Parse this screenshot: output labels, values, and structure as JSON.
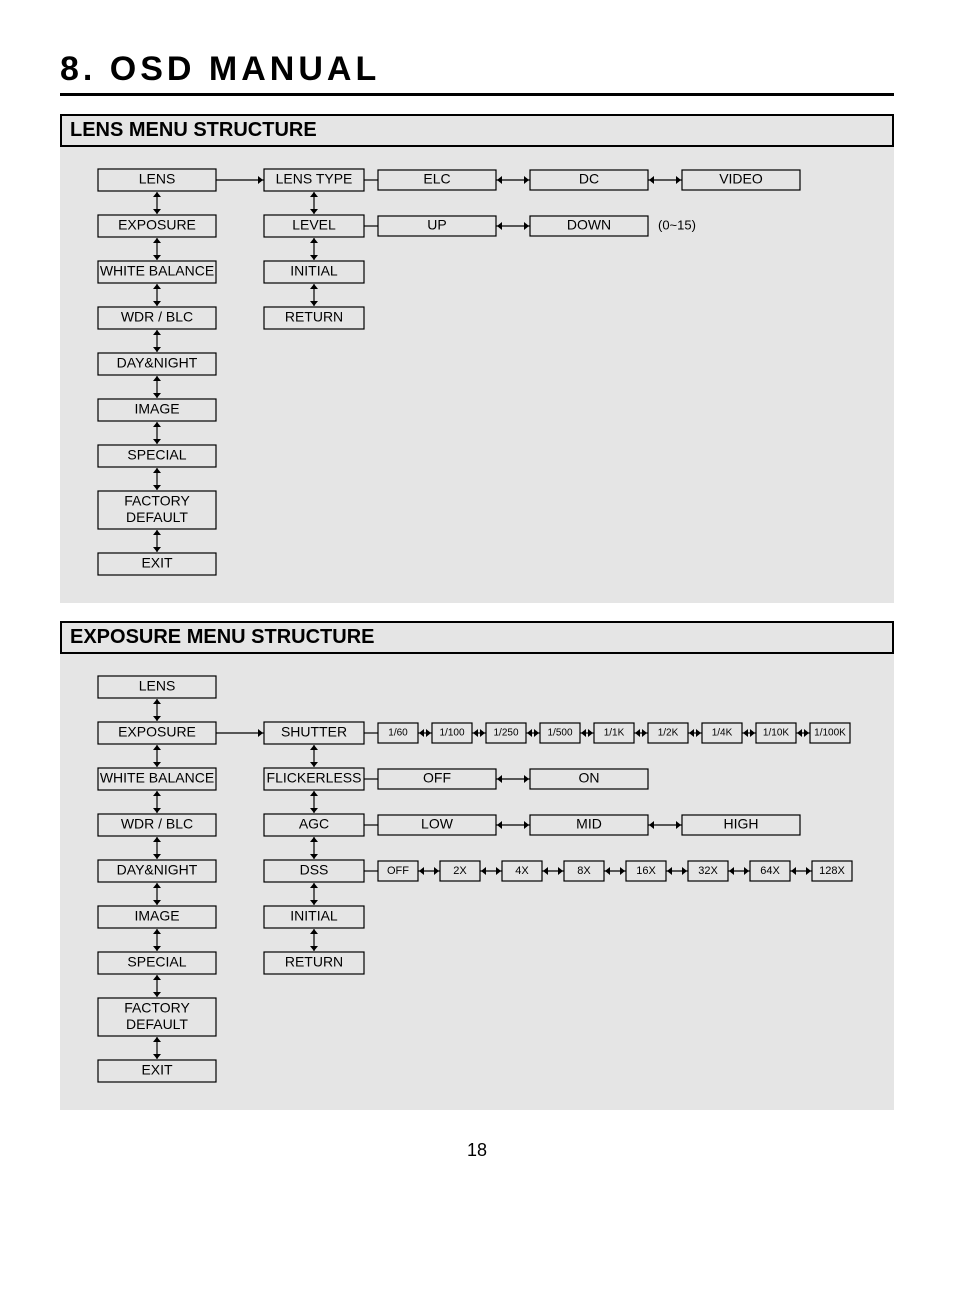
{
  "chapterTitle": "8. OSD MANUAL",
  "pageNumber": "18",
  "sections": [
    {
      "title": "LENS MENU STRUCTURE",
      "mainMenu": [
        "LENS",
        "EXPOSURE",
        "WHITE BALANCE",
        "WDR / BLC",
        "DAY&NIGHT",
        "IMAGE",
        "SPECIAL",
        "FACTORY DEFAULT",
        "EXIT"
      ],
      "activeIndex": 0,
      "subMenu": [
        "LENS TYPE",
        "LEVEL",
        "INITIAL",
        "RETURN"
      ],
      "optionRows": [
        {
          "subIndex": 0,
          "options": [
            "ELC",
            "DC",
            "VIDEO"
          ],
          "note": ""
        },
        {
          "subIndex": 1,
          "options": [
            "UP",
            "DOWN"
          ],
          "note": "(0~15)"
        }
      ]
    },
    {
      "title": "EXPOSURE MENU STRUCTURE",
      "mainMenu": [
        "LENS",
        "EXPOSURE",
        "WHITE BALANCE",
        "WDR / BLC",
        "DAY&NIGHT",
        "IMAGE",
        "SPECIAL",
        "FACTORY DEFAULT",
        "EXIT"
      ],
      "activeIndex": 1,
      "subMenu": [
        "SHUTTER",
        "FLICKERLESS",
        "AGC",
        "DSS",
        "INITIAL",
        "RETURN"
      ],
      "optionRows": [
        {
          "subIndex": 0,
          "options": [
            "1/60",
            "1/100",
            "1/250",
            "1/500",
            "1/1K",
            "1/2K",
            "1/4K",
            "1/10K",
            "1/100K"
          ],
          "note": ""
        },
        {
          "subIndex": 1,
          "options": [
            "OFF",
            "ON"
          ],
          "note": ""
        },
        {
          "subIndex": 2,
          "options": [
            "LOW",
            "MID",
            "HIGH"
          ],
          "note": ""
        },
        {
          "subIndex": 3,
          "options": [
            "OFF",
            "2X",
            "4X",
            "8X",
            "16X",
            "32X",
            "64X",
            "128X"
          ],
          "note": ""
        }
      ]
    }
  ]
}
